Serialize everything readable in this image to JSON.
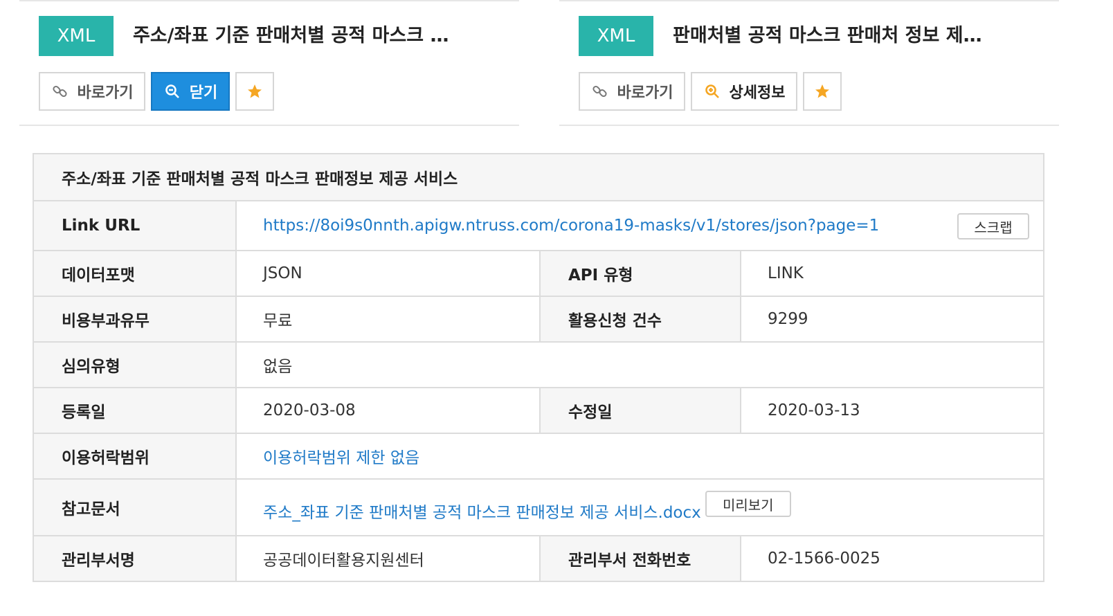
{
  "cards": [
    {
      "badge": "XML",
      "title": "주소/좌표 기준 판매처별 공적 마스크 …",
      "buttons": {
        "link": "바로가기",
        "toggle": "닫기"
      }
    },
    {
      "badge": "XML",
      "title": "판매처별 공적 마스크 판매처 정보 제…",
      "buttons": {
        "link": "바로가기",
        "toggle": "상세정보"
      }
    }
  ],
  "detail": {
    "header": "주소/좌표 기준 판매처별 공적 마스크 판매정보 제공 서비스",
    "link_url_label": "Link URL",
    "link_url": "https://8oi9s0nnth.apigw.ntruss.com/corona19-masks/v1/stores/json?page=1",
    "scrap_label": "스크랩",
    "data_format_label": "데이터포맷",
    "data_format": "JSON",
    "api_type_label": "API 유형",
    "api_type": "LINK",
    "fee_label": "비용부과유무",
    "fee": "무료",
    "apply_count_label": "활용신청 건수",
    "apply_count": "9299",
    "review_label": "심의유형",
    "review": "없음",
    "registered_label": "등록일",
    "registered": "2020-03-08",
    "modified_label": "수정일",
    "modified": "2020-03-13",
    "license_label": "이용허락범위",
    "license": "이용허락범위 제한 없음",
    "reference_label": "참고문서",
    "reference": "주소_좌표 기준 판매처별 공적 마스크 판매정보 제공 서비스.docx",
    "preview_label": "미리보기",
    "dept_label": "관리부서명",
    "dept": "공공데이터활용지원센터",
    "phone_label": "관리부서 전화번호",
    "phone": "02-1566-0025"
  },
  "colors": {
    "badge": "#29b4aa",
    "primary": "#1e8ede",
    "link": "#1f7ac7",
    "star": "#f5a623"
  },
  "icons": [
    "link-icon",
    "zoom-out-icon",
    "zoom-in-icon",
    "star-icon"
  ]
}
